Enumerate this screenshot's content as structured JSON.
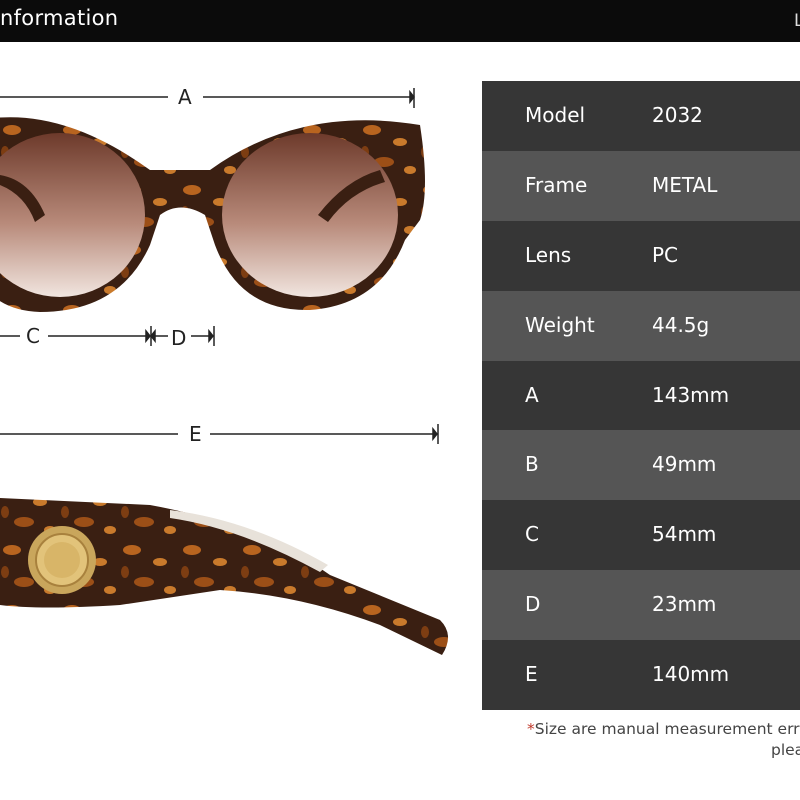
{
  "header": {
    "title": "nformation",
    "right_letter": "L"
  },
  "dimensions": {
    "a": "A",
    "c": "C",
    "d": "D",
    "e": "E"
  },
  "specs": [
    {
      "key": "Model",
      "value": "2032"
    },
    {
      "key": "Frame",
      "value": "METAL"
    },
    {
      "key": "Lens",
      "value": "PC"
    },
    {
      "key": "Weight",
      "value": "44.5g"
    },
    {
      "key": "A",
      "value": "143mm"
    },
    {
      "key": "B",
      "value": "49mm"
    },
    {
      "key": "C",
      "value": "54mm"
    },
    {
      "key": "D",
      "value": "23mm"
    },
    {
      "key": "E",
      "value": "140mm"
    }
  ],
  "note": {
    "star": "*",
    "line1": "Size are manual measurement error",
    "line2": "plea"
  },
  "colors": {
    "tortoise_dark": "#3a1f12",
    "tortoise_light": "#b8641f",
    "lens_top": "#7a4a3a",
    "table_dark": "#363636",
    "table_light": "#555555"
  }
}
